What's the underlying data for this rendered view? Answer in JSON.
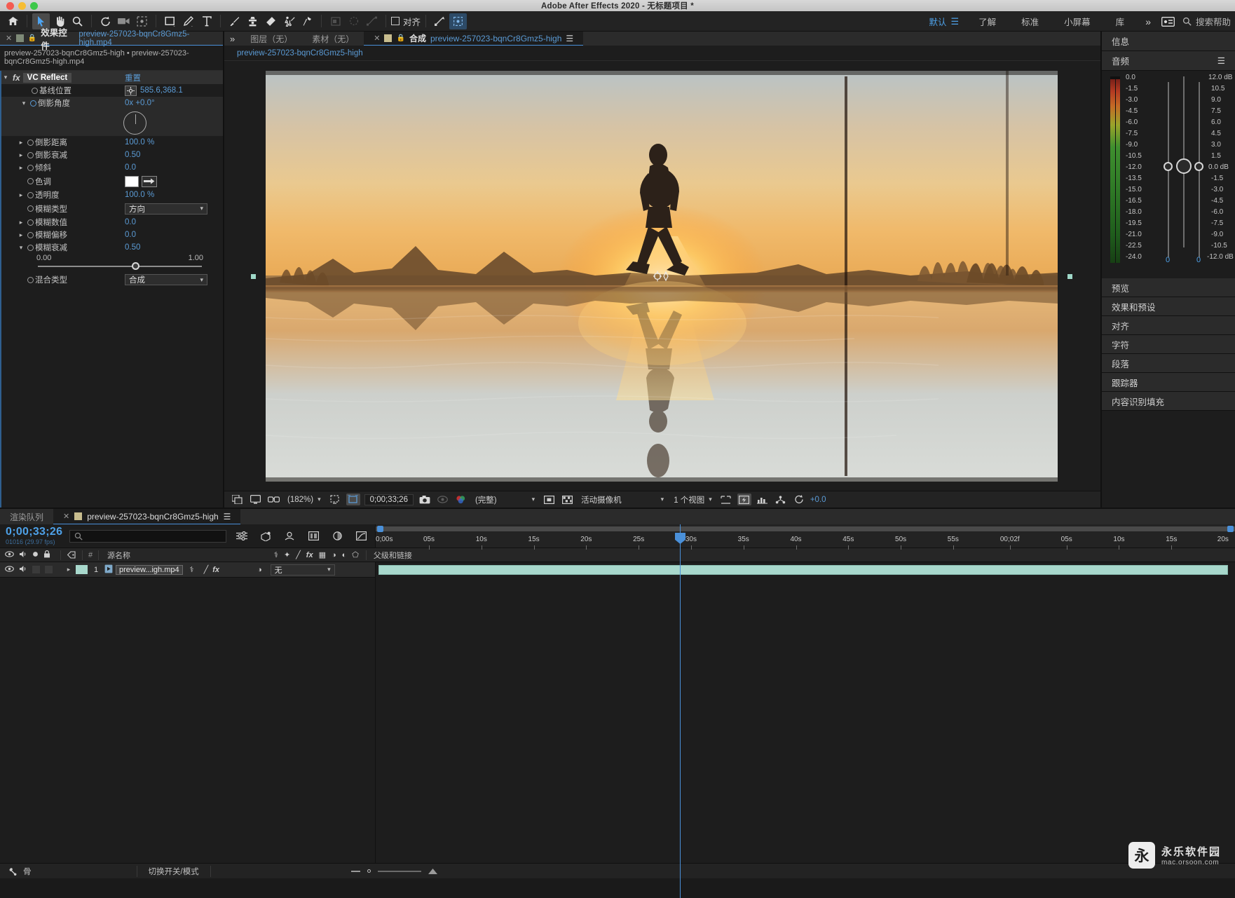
{
  "window": {
    "title": "Adobe After Effects 2020 - 无标题项目 *"
  },
  "toolbar": {
    "tools": [
      {
        "name": "home-icon",
        "label": "主页"
      },
      {
        "name": "selection-tool-icon",
        "label": "选取工具"
      },
      {
        "name": "hand-tool-icon",
        "label": "手形工具"
      },
      {
        "name": "zoom-tool-icon",
        "label": "缩放工具"
      },
      {
        "name": "rotation-tool-icon",
        "label": "旋转工具"
      },
      {
        "name": "camera-tool-icon",
        "label": "摄像机工具"
      },
      {
        "name": "pan-behind-tool-icon",
        "label": "向后平移工具"
      },
      {
        "name": "shape-tool-icon",
        "label": "形状工具"
      },
      {
        "name": "pen-tool-icon",
        "label": "钢笔工具"
      },
      {
        "name": "text-tool-icon",
        "label": "文字工具"
      },
      {
        "name": "brush-tool-icon",
        "label": "画笔工具"
      },
      {
        "name": "clone-stamp-tool-icon",
        "label": "仿制图章工具"
      },
      {
        "name": "eraser-tool-icon",
        "label": "橡皮擦工具"
      },
      {
        "name": "roto-brush-tool-icon",
        "label": "Roto 笔刷工具"
      },
      {
        "name": "puppet-pin-tool-icon",
        "label": "人偶位置控点工具"
      }
    ],
    "snap_label": "对齐",
    "workspaces": [
      "默认",
      "了解",
      "标准",
      "小屏幕",
      "库"
    ],
    "current_workspace": "默认",
    "overflow_label": "»",
    "search_placeholder": "搜索帮助"
  },
  "effect_controls": {
    "tab_title": "效果控件",
    "tab_file": "preview-257023-bqnCr8Gmz5-high.mp4",
    "breadcrumb": "preview-257023-bqnCr8Gmz5-high • preview-257023-bqnCr8Gmz5-high.mp4",
    "effect_name": "VC Reflect",
    "reset_label": "重置",
    "properties": [
      {
        "label": "基线位置",
        "value": "585.6,368.1",
        "type": "point"
      },
      {
        "label": "倒影角度",
        "value": "0x +0.0°",
        "type": "angle"
      },
      {
        "label": "倒影距离",
        "value": "100.0 %",
        "type": "number"
      },
      {
        "label": "倒影衰减",
        "value": "0.50",
        "type": "number"
      },
      {
        "label": "倾斜",
        "value": "0.0",
        "type": "number"
      },
      {
        "label": "色调",
        "value": "",
        "type": "color"
      },
      {
        "label": "透明度",
        "value": "100.0 %",
        "type": "number"
      },
      {
        "label": "模糊类型",
        "value": "方向",
        "type": "dropdown"
      },
      {
        "label": "模糊数值",
        "value": "0.0",
        "type": "number"
      },
      {
        "label": "模糊偏移",
        "value": "0.0",
        "type": "number"
      },
      {
        "label": "模糊衰减",
        "value": "0.50",
        "type": "number_expanded"
      }
    ],
    "slider": {
      "min": "0.00",
      "max": "1.00",
      "value": 0.5
    },
    "blend": {
      "label": "混合类型",
      "value": "合成"
    }
  },
  "comp_panel": {
    "tabs": [
      {
        "label": "图层（无）",
        "active": false
      },
      {
        "label": "素材（无）",
        "active": false
      },
      {
        "label": "合成",
        "file": "preview-257023-bqnCr8Gmz5-high",
        "active": true
      }
    ],
    "breadcrumb": "preview-257023-bqnCr8Gmz5-high",
    "footer": {
      "zoom": "(182%)",
      "timecode": "0;00;33;26",
      "quality": "(完整)",
      "camera": "活动摄像机",
      "views": "1 个视图",
      "exposure": "+0.0"
    }
  },
  "right_dock": {
    "info_label": "信息",
    "audio_label": "音频",
    "meter_scale": [
      "0.0",
      "-1.5",
      "-3.0",
      "-4.5",
      "-6.0",
      "-7.5",
      "-9.0",
      "-10.5",
      "-12.0",
      "-13.5",
      "-15.0",
      "-16.5",
      "-18.0",
      "-19.5",
      "-21.0",
      "-22.5",
      "-24.0"
    ],
    "fader_scale": [
      "12.0 dB",
      "10.5",
      "9.0",
      "7.5",
      "6.0",
      "4.5",
      "3.0",
      "1.5",
      "0.0 dB",
      "-1.5",
      "-3.0",
      "-4.5",
      "-6.0",
      "-7.5",
      "-9.0",
      "-10.5",
      "-12.0 dB"
    ],
    "fader_values": [
      "0",
      "0"
    ],
    "panels": [
      "预览",
      "效果和预设",
      "对齐",
      "字符",
      "段落",
      "跟踪器",
      "内容识别填充"
    ]
  },
  "timeline": {
    "tabs": [
      {
        "label": "渲染队列",
        "active": false
      },
      {
        "label": "preview-257023-bqnCr8Gmz5-high",
        "active": true
      }
    ],
    "current_time": "0;00;33;26",
    "frame_info": "01016 (29.97 fps)",
    "search_placeholder": "",
    "columns": {
      "source_name": "源名称",
      "parent_link": "父级和链接"
    },
    "ruler_ticks": [
      "0;00s",
      "05s",
      "10s",
      "15s",
      "20s",
      "25s",
      "30s",
      "35s",
      "40s",
      "45s",
      "50s",
      "55s",
      "00;02f",
      "05s",
      "10s",
      "15s",
      "20s"
    ],
    "layers": [
      {
        "index": "1",
        "name": "preview...igh.mp4",
        "parent": "无"
      }
    ],
    "footer_label": "切换开关/模式",
    "bone_label": "骨"
  },
  "watermark": {
    "glyph": "永",
    "line1": "永乐软件园",
    "line2": "mac.orsoon.com"
  },
  "colors": {
    "accent_blue": "#4a90d9",
    "value_blue": "#5b9bd5",
    "panel_bg": "#1d1d1d",
    "tab_bg": "#2b2b2b",
    "layer_teal": "#a8d8cc"
  }
}
